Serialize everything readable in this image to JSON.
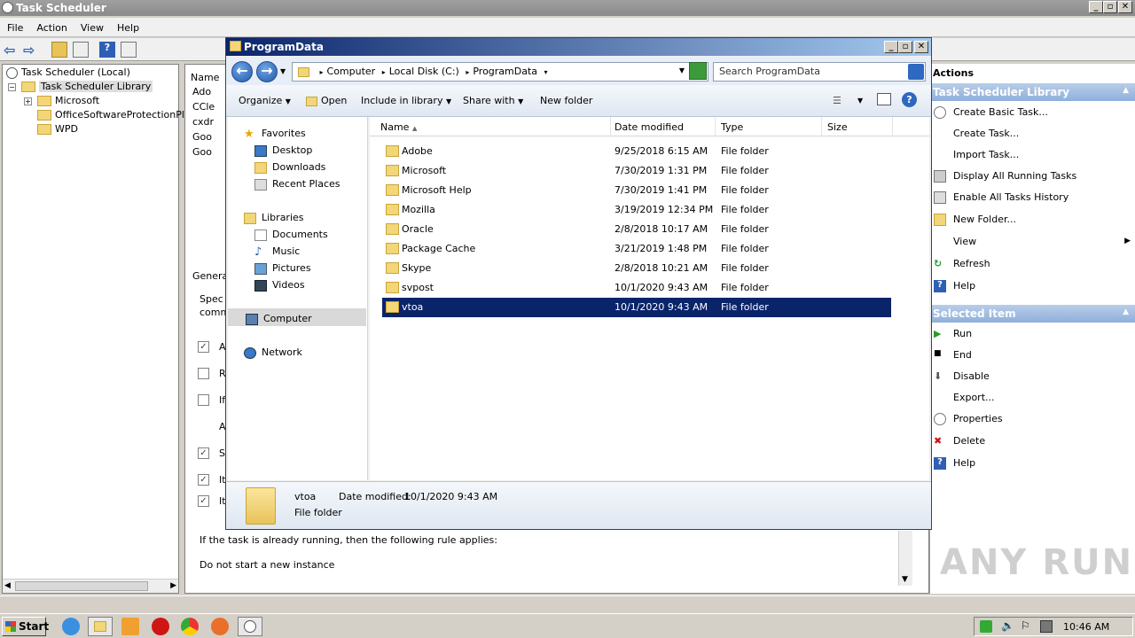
{
  "task_scheduler": {
    "title": "Task Scheduler",
    "menu": [
      "File",
      "Action",
      "View",
      "Help"
    ],
    "tree": {
      "root": "Task Scheduler (Local)",
      "library": "Task Scheduler Library",
      "children": [
        "Microsoft",
        "OfficeSoftwareProtectionPla",
        "WPD"
      ]
    },
    "middle": {
      "col_name": "Name",
      "tasks": [
        "Ado",
        "CCle",
        "cxdr",
        "Goo",
        "Goo"
      ],
      "general_tab": "Genera",
      "spec_text": "Spec",
      "comm_text": "comm",
      "rule_text": "If the task is already running, then the following rule applies:",
      "rule_value": "Do not start a new instance",
      "letters": [
        "A",
        "R",
        "If",
        "A",
        "S",
        "It",
        "It"
      ]
    },
    "actions": {
      "header": "Actions",
      "section1": "Task Scheduler Library",
      "items1": [
        "Create Basic Task...",
        "Create Task...",
        "Import Task...",
        "Display All Running Tasks",
        "Enable All Tasks History",
        "New Folder...",
        "View",
        "Refresh",
        "Help"
      ],
      "section2": "Selected Item",
      "items2": [
        "Run",
        "End",
        "Disable",
        "Export...",
        "Properties",
        "Delete",
        "Help"
      ]
    }
  },
  "explorer": {
    "title": "ProgramData",
    "breadcrumb": [
      "Computer",
      "Local Disk (C:)",
      "ProgramData"
    ],
    "search_placeholder": "Search ProgramData",
    "commands": {
      "organize": "Organize",
      "open": "Open",
      "include": "Include in library",
      "share": "Share with",
      "new_folder": "New folder"
    },
    "nav": {
      "favorites": "Favorites",
      "fav_items": [
        "Desktop",
        "Downloads",
        "Recent Places"
      ],
      "libraries": "Libraries",
      "lib_items": [
        "Documents",
        "Music",
        "Pictures",
        "Videos"
      ],
      "computer": "Computer",
      "network": "Network"
    },
    "columns": [
      "Name",
      "Date modified",
      "Type",
      "Size"
    ],
    "files": [
      {
        "name": "Adobe",
        "date": "9/25/2018 6:15 AM",
        "type": "File folder"
      },
      {
        "name": "Microsoft",
        "date": "7/30/2019 1:31 PM",
        "type": "File folder"
      },
      {
        "name": "Microsoft Help",
        "date": "7/30/2019 1:41 PM",
        "type": "File folder"
      },
      {
        "name": "Mozilla",
        "date": "3/19/2019 12:34 PM",
        "type": "File folder"
      },
      {
        "name": "Oracle",
        "date": "2/8/2018 10:17 AM",
        "type": "File folder"
      },
      {
        "name": "Package Cache",
        "date": "3/21/2019 1:48 PM",
        "type": "File folder"
      },
      {
        "name": "Skype",
        "date": "2/8/2018 10:21 AM",
        "type": "File folder"
      },
      {
        "name": "svpost",
        "date": "10/1/2020 9:43 AM",
        "type": "File folder"
      },
      {
        "name": "vtoa",
        "date": "10/1/2020 9:43 AM",
        "type": "File folder"
      }
    ],
    "details": {
      "name": "vtoa",
      "date_label": "Date modified:",
      "date_value": "10/1/2020 9:43 AM",
      "type": "File folder"
    }
  },
  "taskbar": {
    "start": "Start",
    "clock": "10:46 AM"
  },
  "watermark": "ANY RUN"
}
